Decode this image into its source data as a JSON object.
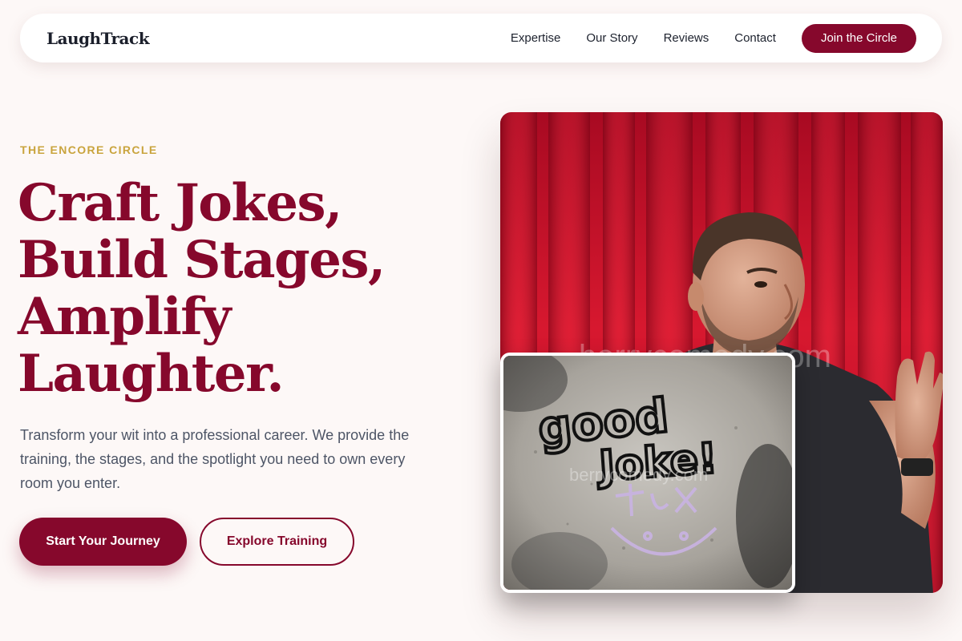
{
  "nav": {
    "logo": "LaughTrack",
    "links": [
      "Expertise",
      "Our Story",
      "Reviews",
      "Contact"
    ],
    "cta": "Join the Circle"
  },
  "hero": {
    "eyebrow": "THE ENCORE CIRCLE",
    "headline": [
      "Craft Jokes,",
      "Build Stages,",
      "Amplify",
      "Laughter."
    ],
    "subtext": "Transform your wit into a professional career. We provide the training, the stages, and the spotlight you need to own every room you enter.",
    "primary_cta": "Start Your Journey",
    "secondary_cta": "Explore Training"
  },
  "images": {
    "main_watermark": "berrycomedy.com",
    "inset_watermark": "berrycomedy.com",
    "inset_graffiti": [
      "good",
      "Joke!"
    ]
  },
  "colors": {
    "brand": "#86082c",
    "accent_gold": "#c9a43d",
    "background": "#fdf8f7",
    "curtain": "#c8102e"
  }
}
